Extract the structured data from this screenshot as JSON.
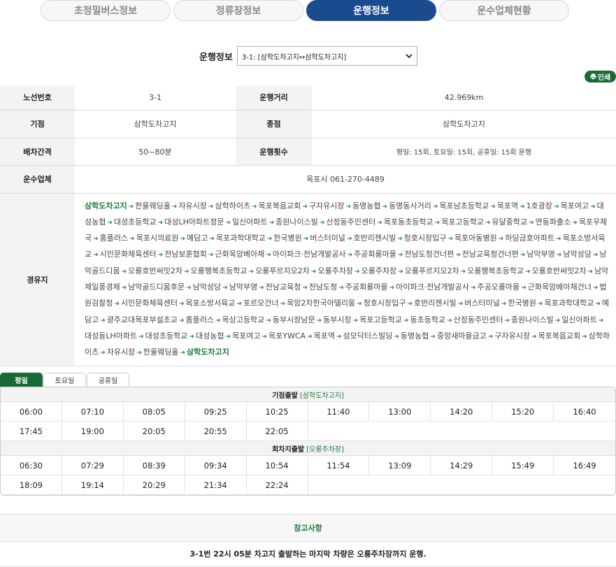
{
  "tabs": [
    "초정밀버스정보",
    "정류장정보",
    "운행정보",
    "운수업체현황"
  ],
  "active_tab": 2,
  "selector": {
    "label": "운행정보",
    "value": "3-1: [삼학도차고지↔삼학도차고지]"
  },
  "print_label": "인쇄",
  "info": {
    "route_no_label": "노선번호",
    "route_no": "3-1",
    "distance_label": "운행거리",
    "distance": "42.969km",
    "start_label": "기점",
    "start": "삼학도차고지",
    "end_label": "종점",
    "end": "삼학도차고지",
    "interval_label": "배차간격",
    "interval": "50~80분",
    "trips_label": "운행횟수",
    "trips": "평일: 15회, 토요일: 15회, 공휴일: 15회 운행",
    "company_label": "운수업체",
    "company": "목포시 061-270-4489",
    "via_label": "경유지"
  },
  "stops": [
    "삼학도차고지",
    "한울웨딩홀",
    "자유시장",
    "삼학하이츠",
    "목포복음교회",
    "구자유시장",
    "동명농협",
    "동명동사거리",
    "목포남초등학교",
    "목포역",
    "1호광장",
    "목포여고",
    "대성농협",
    "대성초등학교",
    "대성LH아파트정문",
    "일신아파트",
    "종원나이스빌",
    "산정동주민센터",
    "목포동초등학교",
    "목포고등학교",
    "유달중학교",
    "연동파출소",
    "목포우체국",
    "홈플러스",
    "목포시의료원",
    "예담고",
    "목포과학대학교",
    "한국병원",
    "버스터미널",
    "호반리젠시빌",
    "청호시장입구",
    "목포아동병원",
    "하당금호아파트",
    "목포소방서육교",
    "시민문화체육센터",
    "전남보훈협회",
    "근화옥암베아채",
    "아이파크·전남개발공사",
    "주공회룡마을",
    "전남도청건너편",
    "전남교육청건너편",
    "남악부영",
    "남악성당",
    "남악골드디움",
    "오룡호반써밋2차",
    "오룡행복초등학교",
    "오룡푸르지오2차",
    "오룡주차장",
    "오룡주차장",
    "오룡푸르지오2차",
    "오룡행복초등학교",
    "오룡호반써밋2차",
    "남악제일풍경채",
    "남악골드디움후문",
    "남악성당",
    "남악부영",
    "전남교육청",
    "전남도청",
    "주공회룡마을",
    "아이파크·전남개발공사",
    "주공오룡마을",
    "근화옥암베아채건너",
    "법원검찰청",
    "시민문화체육센터",
    "목포소방서육교",
    "포르모건너",
    "옥암2차한국아델리움",
    "청호시장입구",
    "호반리젠시빌",
    "버스터미널",
    "한국병원",
    "목포과학대학교",
    "예담고",
    "광주교대목포부설초교",
    "홈플러스",
    "목상고등학교",
    "동부시장남문",
    "동부시장",
    "목포고등학교",
    "동초등학교",
    "산정동주민센터",
    "종원나이스빌",
    "일신아파트",
    "대성동LH아파트",
    "대성초등학교",
    "대성농협",
    "목포여고",
    "목포YWCA",
    "목포역",
    "성모닥터스빌딩",
    "동명농협",
    "중앙새마을금고",
    "구자유시장",
    "목포복음교회",
    "삼학하이츠",
    "자유시장",
    "한울웨딩홀",
    "삼학도차고지"
  ],
  "day_tabs": [
    "평일",
    "토요일",
    "공휴일"
  ],
  "active_day": 0,
  "schedule": [
    {
      "label": "기점출발",
      "place": "[삼학도차고지]",
      "times": [
        "06:00",
        "07:10",
        "08:05",
        "09:25",
        "10:25",
        "11:40",
        "13:00",
        "14:20",
        "15:20",
        "16:40",
        "17:45",
        "19:00",
        "20:05",
        "20:55",
        "22:05"
      ]
    },
    {
      "label": "회차지출발",
      "place": "[오룡주차장]",
      "times": [
        "06:30",
        "07:29",
        "08:39",
        "09:34",
        "10:54",
        "11:54",
        "13:09",
        "14:29",
        "15:49",
        "16:49",
        "18:09",
        "19:14",
        "20:29",
        "21:34",
        "22:24"
      ]
    }
  ],
  "note": {
    "title": "참고사항",
    "text": "3-1번 22시 05분 차고지 출발하는 마지막 차량은 오룡주차장까지 운행."
  }
}
